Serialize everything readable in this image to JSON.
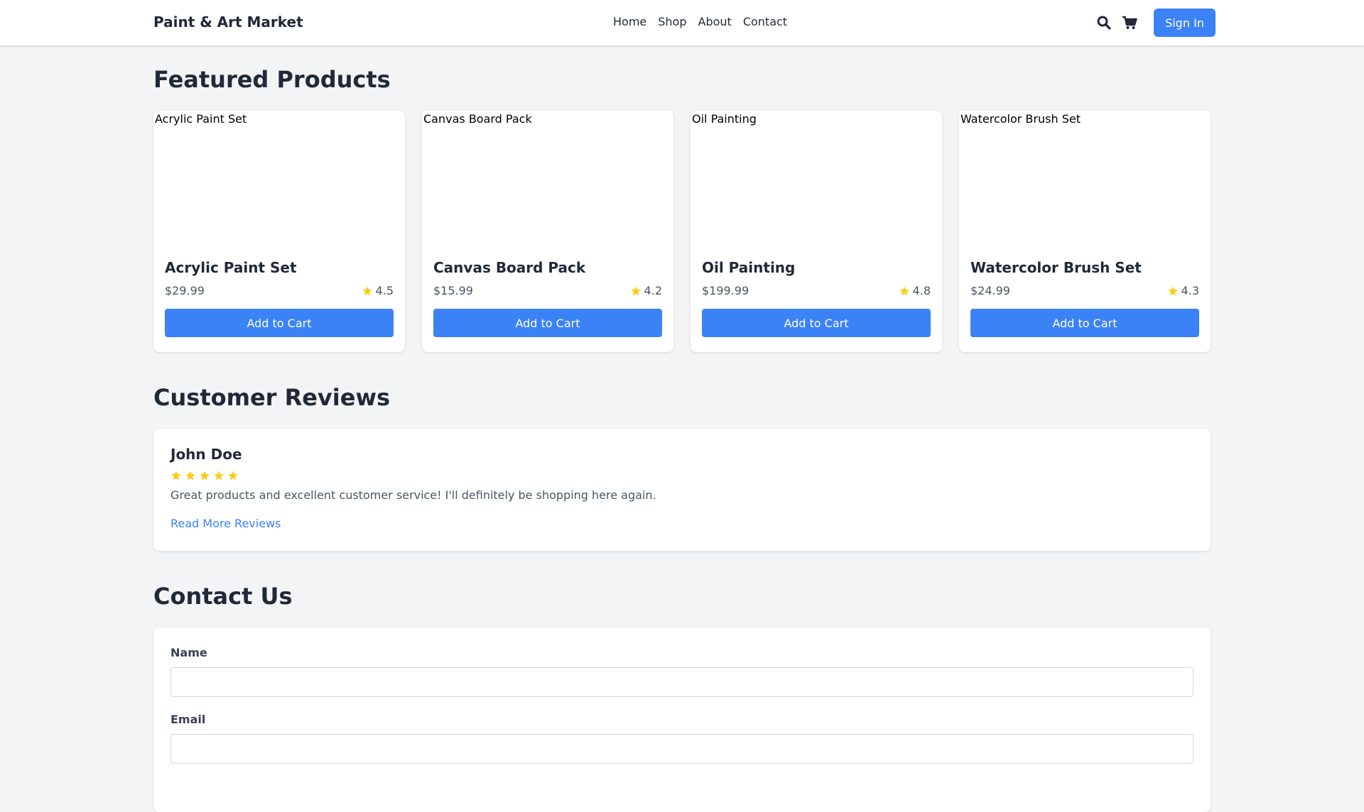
{
  "header": {
    "brand": "Paint & Art Market",
    "nav": [
      "Home",
      "Shop",
      "About",
      "Contact"
    ],
    "sign_in_label": "Sign In",
    "icons": [
      "search-icon",
      "shopping-cart-icon"
    ]
  },
  "colors": {
    "accent": "#3b82f6",
    "star": "#facc15",
    "background": "#f3f4f6",
    "text": "#1f2937"
  },
  "featured": {
    "title": "Featured Products",
    "products": [
      {
        "image_alt": "Acrylic Paint Set",
        "name": "Acrylic Paint Set",
        "price": "$29.99",
        "rating": "4.5",
        "button": "Add to Cart"
      },
      {
        "image_alt": "Canvas Board Pack",
        "name": "Canvas Board Pack",
        "price": "$15.99",
        "rating": "4.2",
        "button": "Add to Cart"
      },
      {
        "image_alt": "Oil Painting",
        "name": "Oil Painting",
        "price": "$199.99",
        "rating": "4.8",
        "button": "Add to Cart"
      },
      {
        "image_alt": "Watercolor Brush Set",
        "name": "Watercolor Brush Set",
        "price": "$24.99",
        "rating": "4.3",
        "button": "Add to Cart"
      }
    ]
  },
  "reviews": {
    "title": "Customer Reviews",
    "review": {
      "name": "John Doe",
      "stars": 5,
      "text": "Great products and excellent customer service! I'll definitely be shopping here again."
    },
    "more_link": "Read More Reviews"
  },
  "contact": {
    "title": "Contact Us",
    "fields": [
      {
        "label": "Name",
        "value": "",
        "placeholder": ""
      },
      {
        "label": "Email",
        "value": "",
        "placeholder": ""
      }
    ]
  }
}
